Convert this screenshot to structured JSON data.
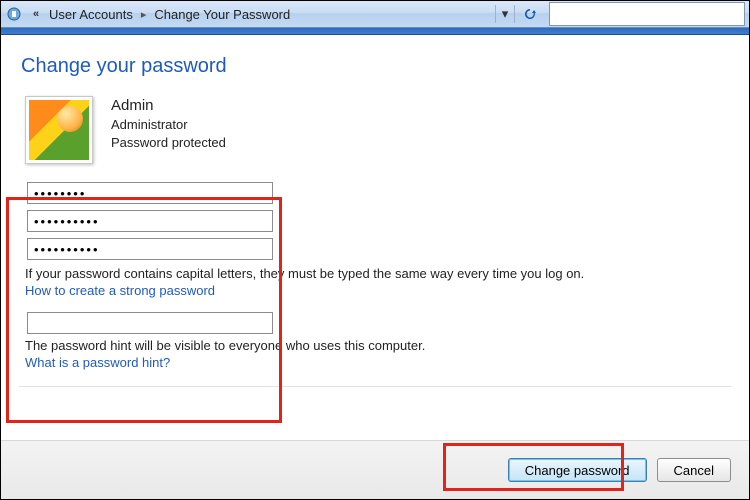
{
  "breadcrumb": [
    "User Accounts",
    "Change Your Password"
  ],
  "search": {
    "value": ""
  },
  "title": "Change your password",
  "user": {
    "name": "Admin",
    "role": "Administrator",
    "status": "Password protected"
  },
  "fields": {
    "current": "abcdefgh",
    "new": "abcdefghij",
    "confirm": "abcdefghij",
    "hint": ""
  },
  "notes": {
    "caps": "If your password contains capital letters, they must be typed the same way every time you log on.",
    "hint": "The password hint will be visible to everyone who uses this computer."
  },
  "links": {
    "strong": "How to create a strong password",
    "hint": "What is a password hint?"
  },
  "buttons": {
    "change": "Change password",
    "cancel": "Cancel"
  },
  "annotation_color": "#e2231a"
}
